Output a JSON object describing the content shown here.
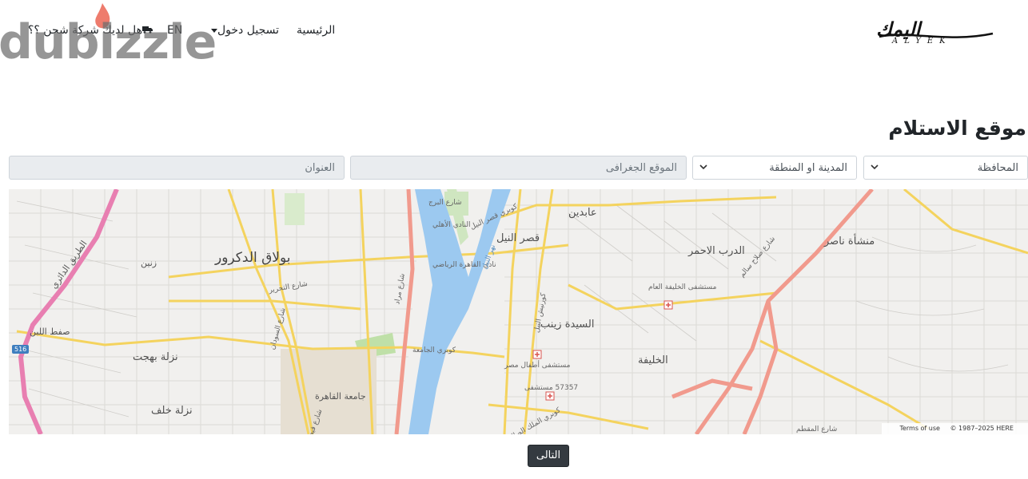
{
  "header": {
    "logo_text": "اليمك",
    "logo_sub": "ALYEK",
    "nav": {
      "home": "الرئيسية",
      "login": "تسجيل دخول",
      "lang": "EN",
      "shipping_question": "هل لديك شركة شحن ؟؟"
    },
    "watermark": "dubizzle"
  },
  "main": {
    "title": "موقع الاستلام",
    "fields": {
      "governorate": "المحافظة",
      "city_area": "المدينة او المنطقة",
      "geo_location_placeholder": "الموقع الجغرافى",
      "address_placeholder": "العنوان"
    },
    "map": {
      "labels": {
        "bulaq_dakrour": "بولاق الدكرور",
        "kasr_el_nil": "قصر النيل",
        "abdeen": "عابدين",
        "darb_el_ahmar": "الدرب الاحمر",
        "manshiyet_nasser": "منشأة ناصر",
        "sayeda_zeinab": "السيدة زينب",
        "khalifa": "الخليفة",
        "zenin": "زنين",
        "saft_el_laban": "صفط اللبن",
        "nazlet_bahgat": "نزلة بهجت",
        "nazlet_khalaf": "نزلة خلف",
        "cairo_university": "جامعة القاهرة",
        "ring_road": "الطريق الدائري",
        "kornish_el_nil": "كورنيش النيل",
        "salah_salem": "شارع صلاح سالم",
        "khalifa_hospital": "مستشفى الخليفة العام",
        "children_hospital": "مستشفى أطفال مصر",
        "hospital_57357": "57357 مستشفى",
        "kasr_el_nil_bridge": "كوبري قصر النيل",
        "galaa_bridge": "كوبري الجامعة",
        "tahrir_street": "شارع التحرير",
        "morad_street": "شارع مراد",
        "abbas_bridge": "كوبري الملك الصالح",
        "gazira_club": "نادي القاهرة الرياضي",
        "ahly_club": "النادي الأهلي",
        "burg_street": "شارع البرج",
        "nile": "نهر النيل",
        "sudan_street": "شارع السودان",
        "faisal_street": "شارع فيصل",
        "mokattam_street": "شارع المقطم",
        "road_516": "516"
      },
      "terms": "Terms of use",
      "copyright": "© 1987–2025 HERE"
    },
    "next_button": "التالى"
  },
  "colors": {
    "water": "#9cc9f0",
    "highway": "#f19a8d",
    "major_road": "#fbe58a",
    "park": "#cfe6c0",
    "button": "#343a40"
  }
}
